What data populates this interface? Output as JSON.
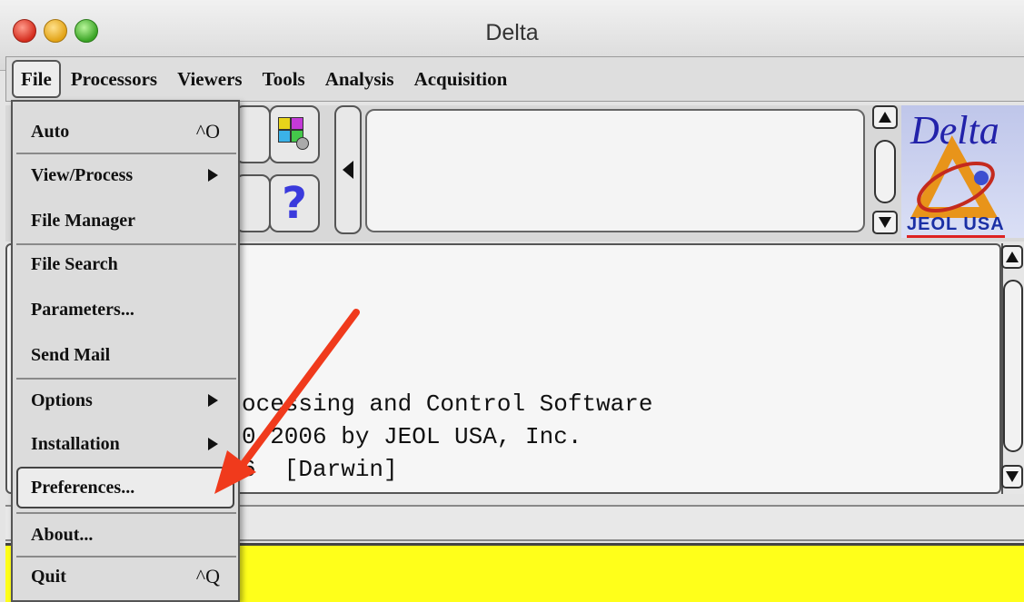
{
  "window": {
    "title": "Delta"
  },
  "menubar": {
    "items": [
      {
        "label": "File"
      },
      {
        "label": "Processors"
      },
      {
        "label": "Viewers"
      },
      {
        "label": "Tools"
      },
      {
        "label": "Analysis"
      },
      {
        "label": "Acquisition"
      }
    ]
  },
  "file_menu": {
    "items": [
      {
        "label": "Auto",
        "shortcut": "^O"
      },
      {
        "label": "View/Process",
        "submenu": true
      },
      {
        "label": "File Manager"
      },
      {
        "label": "File Search"
      },
      {
        "label": "Parameters..."
      },
      {
        "label": "Send Mail"
      },
      {
        "label": "Options",
        "submenu": true
      },
      {
        "label": "Installation",
        "submenu": true
      },
      {
        "label": "Preferences..."
      },
      {
        "label": "About..."
      },
      {
        "label": "Quit",
        "shortcut": "^Q"
      }
    ]
  },
  "toolbar": {
    "help_glyph": "?",
    "icons": [
      "palette-icon",
      "help-icon",
      "collapse-arrow-icon"
    ]
  },
  "logo": {
    "script": "Delta",
    "brand": "JEOL USA"
  },
  "console": {
    "lines": [
      "ocessing and Control Software",
      "0-2006 by JEOL USA, Inc.",
      "6  [Darwin]"
    ]
  },
  "colors": {
    "annotation_arrow": "#f03a1c",
    "command_line": "#ffff1a",
    "menu_bg": "#dcdcdc"
  }
}
